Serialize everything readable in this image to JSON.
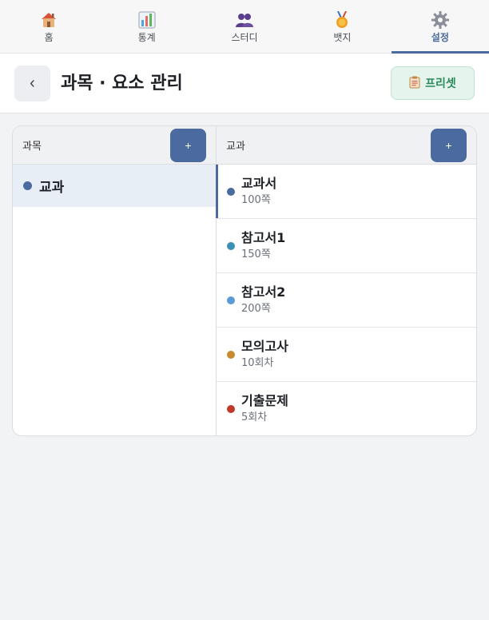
{
  "nav": {
    "tabs": [
      {
        "label": "홈",
        "icon": "house-icon"
      },
      {
        "label": "통계",
        "icon": "bar-chart-icon"
      },
      {
        "label": "스터디",
        "icon": "people-icon"
      },
      {
        "label": "뱃지",
        "icon": "medal-icon"
      },
      {
        "label": "설정",
        "icon": "gear-icon",
        "active": true
      }
    ]
  },
  "header": {
    "back_label": "‹",
    "title": "과목 · 요소 관리",
    "preset_label": "프리셋",
    "preset_icon": "clipboard-icon"
  },
  "subjects": {
    "title": "과목",
    "add_label": "+",
    "items": [
      {
        "label": "교과",
        "color": "#4a6aa0",
        "selected": true
      }
    ]
  },
  "elements": {
    "title": "교과",
    "add_label": "+",
    "items": [
      {
        "name": "교과서",
        "amount": "100쪽",
        "color": "#4a6aa0"
      },
      {
        "name": "참고서1",
        "amount": "150쪽",
        "color": "#3a8fb5"
      },
      {
        "name": "참고서2",
        "amount": "200쪽",
        "color": "#5a9ad6"
      },
      {
        "name": "모의고사",
        "amount": "10회차",
        "color": "#c88a2e"
      },
      {
        "name": "기출문제",
        "amount": "5회차",
        "color": "#c0392b"
      }
    ]
  },
  "colors": {
    "accent": "#4a6aa0",
    "preset_green": "#2a8a5a"
  }
}
